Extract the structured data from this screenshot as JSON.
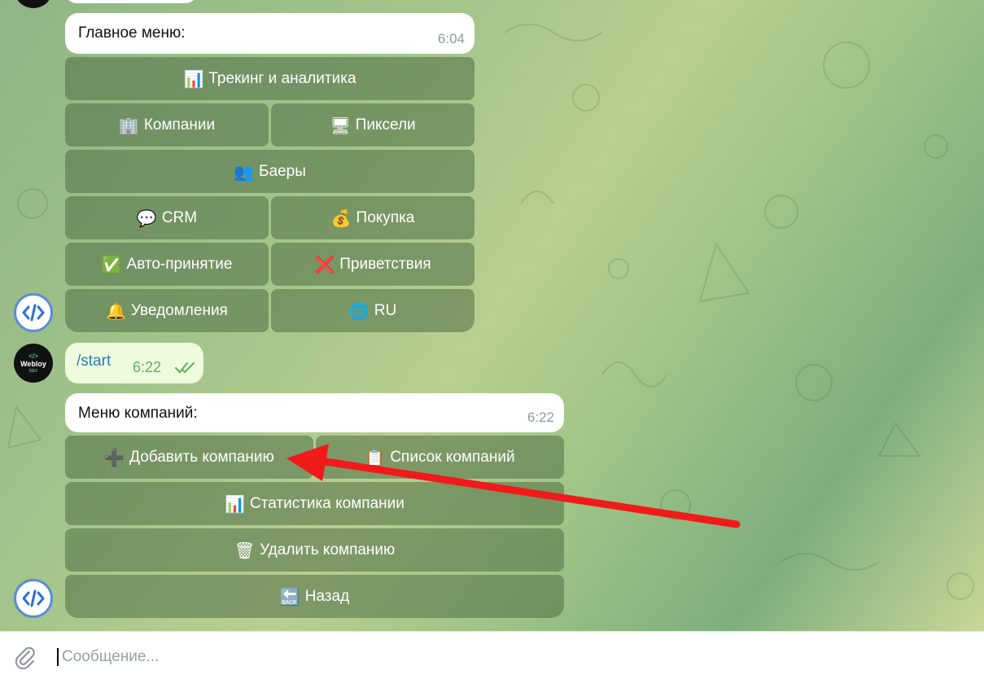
{
  "messages": {
    "main_menu": {
      "text": "Главное меню:",
      "time": "6:04",
      "buttons": [
        {
          "icon": "bar-chart-icon",
          "emoji": "📊",
          "label": "Трекинг и аналитика"
        },
        {
          "icon": "office-building-icon",
          "emoji": "🏢",
          "label": "Компании"
        },
        {
          "icon": "desktop-computer-icon",
          "emoji": "🖥",
          "label": "Пиксели"
        },
        {
          "icon": "people-icon",
          "emoji": "👥",
          "label": "Баеры"
        },
        {
          "icon": "speech-bubble-icon",
          "emoji": "💬",
          "label": "CRM"
        },
        {
          "icon": "money-bag-icon",
          "emoji": "💰",
          "label": "Покупка"
        },
        {
          "icon": "check-mark-icon",
          "emoji": "✅",
          "label": "Авто-принятие"
        },
        {
          "icon": "cross-mark-icon",
          "emoji": "❌",
          "label": "Приветствия"
        },
        {
          "icon": "bell-icon",
          "emoji": "🔔",
          "label": "Уведомления"
        },
        {
          "icon": "globe-icon",
          "emoji": "🌐",
          "label": "RU"
        }
      ]
    },
    "start_command": {
      "text": "/start",
      "time": "6:22"
    },
    "companies_menu": {
      "text": "Меню компаний:",
      "time": "6:22",
      "buttons": [
        {
          "icon": "plus-icon",
          "emoji": "➕",
          "label": "Добавить компанию"
        },
        {
          "icon": "clipboard-icon",
          "emoji": "📋",
          "label": "Список компаний"
        },
        {
          "icon": "bar-chart-icon",
          "emoji": "📊",
          "label": "Статистика компании"
        },
        {
          "icon": "trash-icon",
          "emoji": "🗑",
          "label": "Удалить компанию"
        },
        {
          "icon": "back-arrow-icon",
          "emoji": "🔙",
          "label": "Назад"
        }
      ]
    }
  },
  "user_avatar": {
    "line1": "Webloy",
    "line2": "DEV"
  },
  "composer": {
    "placeholder": "Сообщение..."
  },
  "colors": {
    "button_bg": "rgba(80,110,70,0.55)",
    "arrow": "#f01a1a",
    "bot_avatar_border": "#5b8cd8",
    "outgoing_bubble": "#eefbdc",
    "read_checks": "#5fae5f"
  }
}
